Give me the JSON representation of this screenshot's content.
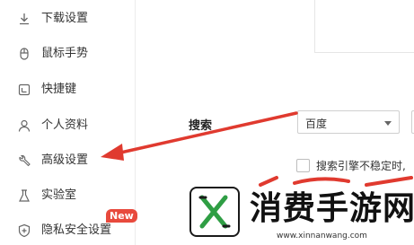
{
  "sidebar": {
    "items": [
      {
        "label": "下载设置",
        "icon": "download-icon"
      },
      {
        "label": "鼠标手势",
        "icon": "mouse-icon"
      },
      {
        "label": "快捷键",
        "icon": "keyboard-shortcut-icon"
      },
      {
        "label": "个人资料",
        "icon": "user-icon"
      },
      {
        "label": "高级设置",
        "icon": "wrench-icon"
      },
      {
        "label": "实验室",
        "icon": "flask-icon"
      },
      {
        "label": "隐私安全设置",
        "icon": "shield-icon",
        "badge": "New"
      }
    ]
  },
  "main": {
    "search_label": "搜索",
    "search_engine": {
      "selected": "百度"
    },
    "checkbox": {
      "label": "搜索引擎不稳定时,",
      "checked": false
    }
  },
  "watermark": {
    "title": "消费手游网",
    "url": "www.xinnanwang.com"
  },
  "colors": {
    "annotation_arrow": "#e03a2f",
    "badge": "#e84a3d"
  }
}
